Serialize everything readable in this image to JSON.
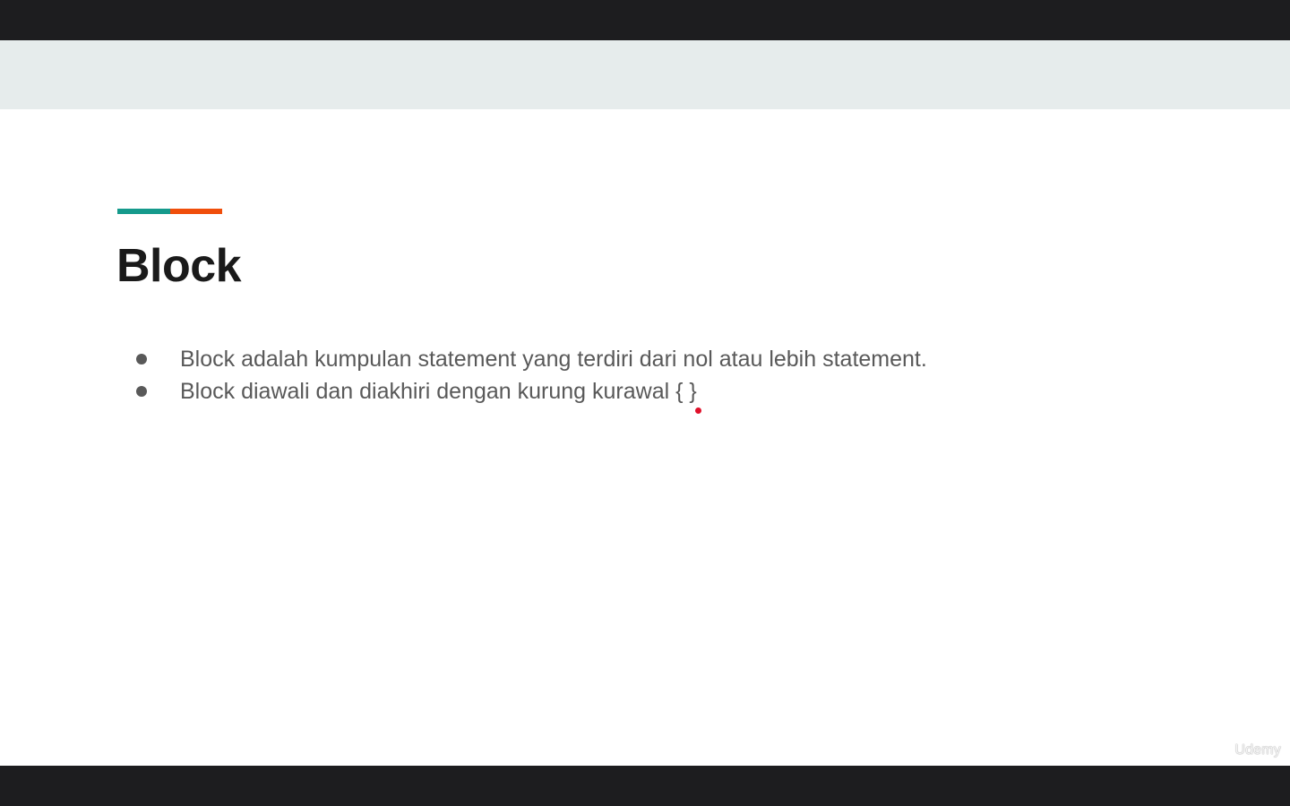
{
  "slide": {
    "title": "Block",
    "bullets": [
      "Block adalah kumpulan statement yang terdiri dari nol atau lebih statement.",
      "Block diawali dan diakhiri dengan kurung kurawal { }"
    ],
    "watermark": "Udemy"
  },
  "colors": {
    "header_band": "#e6ecec",
    "accent_teal": "#159a8c",
    "accent_orange": "#f04e0b",
    "title": "#1a1a1a",
    "body_text": "#595959",
    "pointer": "#e0102a"
  },
  "icons": {
    "pointer": "laser-pointer-dot"
  }
}
